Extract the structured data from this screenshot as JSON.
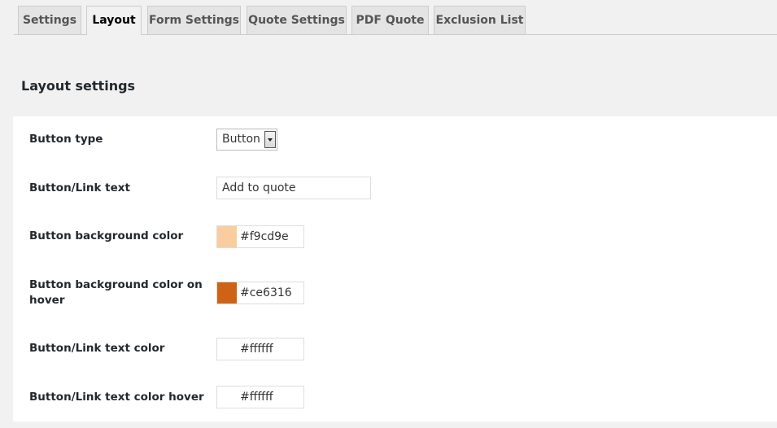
{
  "tabs": [
    {
      "label": "Settings",
      "active": false
    },
    {
      "label": "Layout",
      "active": true
    },
    {
      "label": "Form Settings",
      "active": false
    },
    {
      "label": "Quote Settings",
      "active": false
    },
    {
      "label": "PDF Quote",
      "active": false
    },
    {
      "label": "Exclusion List",
      "active": false
    }
  ],
  "section": {
    "title": "Layout settings"
  },
  "fields": {
    "button_type": {
      "label": "Button type",
      "value": "Button"
    },
    "button_link_text": {
      "label": "Button/Link text",
      "value": "Add to quote"
    },
    "button_bg_color": {
      "label": "Button background color",
      "value": "#f9cd9e",
      "color": "#f9cd9e"
    },
    "button_bg_color_hover": {
      "label": "Button background color on hover",
      "value": "#ce6316",
      "color": "#ce6316"
    },
    "link_text_color": {
      "label": "Button/Link text color",
      "value": "#ffffff",
      "color": "#ffffff"
    },
    "link_text_color_hover": {
      "label": "Button/Link text color hover",
      "value": "#ffffff",
      "color": "#ffffff"
    }
  }
}
